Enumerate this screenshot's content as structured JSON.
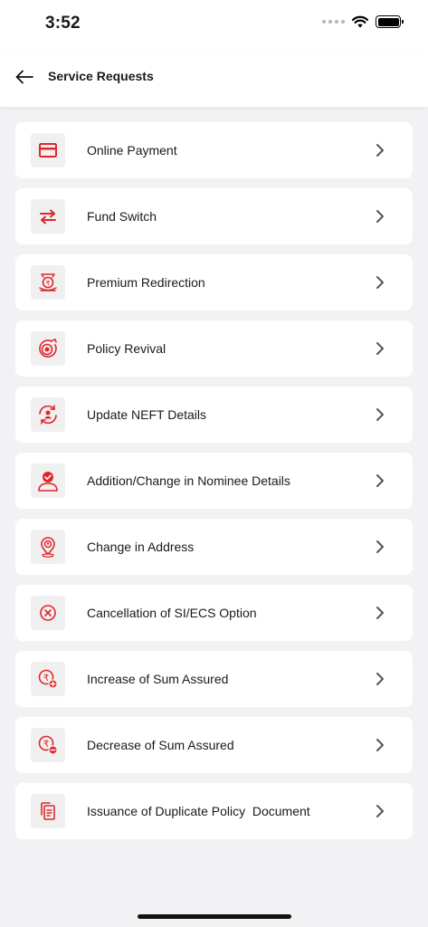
{
  "status_bar": {
    "time": "3:52"
  },
  "header": {
    "title": "Service Requests"
  },
  "accent_color": "#e0262b",
  "items": [
    {
      "label": "Online Payment",
      "icon": "credit-card-icon"
    },
    {
      "label": "Fund Switch",
      "icon": "swap-arrows-icon"
    },
    {
      "label": "Premium Redirection",
      "icon": "rupee-redirect-icon"
    },
    {
      "label": "Policy Revival",
      "icon": "target-revival-icon"
    },
    {
      "label": "Update NEFT Details",
      "icon": "user-refresh-icon"
    },
    {
      "label": "Addition/Change in Nominee Details",
      "icon": "user-check-icon"
    },
    {
      "label": "Change in Address",
      "icon": "location-pin-icon"
    },
    {
      "label": "Cancellation of SI/ECS Option",
      "icon": "cancel-circle-icon"
    },
    {
      "label": "Increase of Sum Assured",
      "icon": "rupee-plus-icon"
    },
    {
      "label": "Decrease of Sum Assured",
      "icon": "rupee-minus-icon"
    },
    {
      "label": "Issuance of Duplicate Policy  Document",
      "icon": "duplicate-document-icon"
    }
  ]
}
